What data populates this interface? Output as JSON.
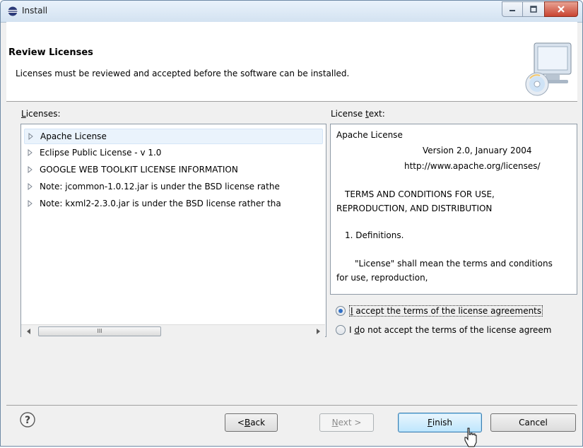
{
  "window": {
    "title": "Install",
    "icon": "eclipse-install-icon"
  },
  "header": {
    "title": "Review Licenses",
    "description": "Licenses must be reviewed and accepted before the software can be installed.",
    "art": "monitor-cd-icon"
  },
  "licenses": {
    "label_pre": "",
    "label_mnemonic": "L",
    "label_post": "icenses:",
    "items": [
      "Apache License",
      "Eclipse Public License - v 1.0",
      "GOOGLE WEB TOOLKIT LICENSE INFORMATION",
      "Note:  jcommon-1.0.12.jar is under the BSD license rathe",
      "Note:  kxml2-2.3.0.jar is under the BSD license rather tha"
    ],
    "selected_index": 0,
    "scroll_grip": "III"
  },
  "license_text": {
    "label_pre": "License ",
    "label_mnemonic": "t",
    "label_post": "ext:",
    "lines": [
      "Apache License",
      "Version 2.0, January 2004",
      "http://www.apache.org/licenses/",
      "TERMS AND CONDITIONS FOR USE,",
      "REPRODUCTION, AND DISTRIBUTION",
      "1. Definitions.",
      "\"License\" shall mean the terms and conditions",
      "for use, reproduction,"
    ]
  },
  "accept": {
    "accept_mnemonic": "I",
    "accept_rest": " accept the terms of the license agreements",
    "decline_pre": "I ",
    "decline_mnemonic": "d",
    "decline_rest": "o not accept the terms of the license agreem",
    "selected": "accept"
  },
  "buttons": {
    "back_pre": "< ",
    "back_mnemonic": "B",
    "back_rest": "ack",
    "next_pre": "",
    "next_mnemonic": "N",
    "next_rest": "ext >",
    "finish_mnemonic": "F",
    "finish_rest": "inish",
    "cancel": "Cancel"
  },
  "colors": {
    "accent": "#2f6fc7",
    "selection": "#eaf3fc",
    "header_bg": "#ffffff",
    "dialog_bg": "#f0f0f0"
  }
}
